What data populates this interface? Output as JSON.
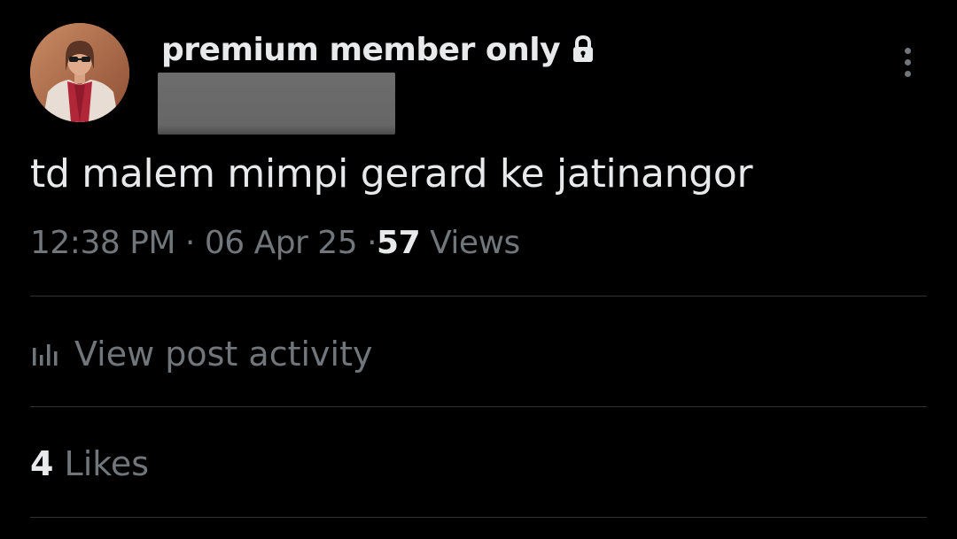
{
  "author": {
    "display_name": "premium member only",
    "avatar": "profile-photo",
    "badge_icon": "lock-icon"
  },
  "post": {
    "text": "td malem mimpi gerard ke jatinangor"
  },
  "meta": {
    "time": "12:38 PM",
    "separator": "·",
    "date": "06 Apr 25",
    "views_count": "57",
    "views_label": "Views"
  },
  "activity": {
    "icon": "analytics-bars-icon",
    "label": "View post activity"
  },
  "likes": {
    "count": "4",
    "label": "Likes"
  },
  "colors": {
    "background": "#000000",
    "primary_text": "#e7e9ea",
    "secondary_text": "#71767b",
    "divider": "#2f3336"
  }
}
